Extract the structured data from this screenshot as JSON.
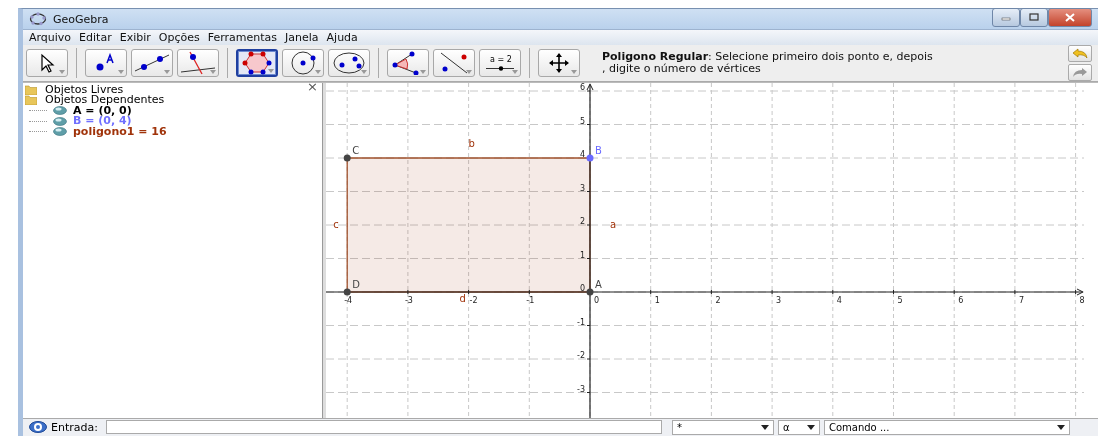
{
  "window": {
    "title": "GeoGebra"
  },
  "menu": [
    "Arquivo",
    "Editar",
    "Exibir",
    "Opções",
    "Ferramentas",
    "Janela",
    "Ajuda"
  ],
  "toolbar": {
    "tools": [
      {
        "kind": "pointer",
        "selected": false
      },
      {
        "kind": "point",
        "selected": false
      },
      {
        "kind": "line",
        "selected": false
      },
      {
        "kind": "perpendicular",
        "selected": false
      },
      {
        "kind": "polygon",
        "selected": true
      },
      {
        "kind": "circle",
        "selected": false
      },
      {
        "kind": "conic",
        "selected": false
      },
      {
        "kind": "angle",
        "selected": false
      },
      {
        "kind": "reflect",
        "selected": false
      },
      {
        "kind": "slider",
        "selected": false,
        "label": "a = 2"
      },
      {
        "kind": "move-view",
        "selected": false
      }
    ],
    "help": [
      "**Poligono Regular**: Selecione primeiro dois ponto e, depois",
      ", digite o número de vértices"
    ]
  },
  "algebra": {
    "close": "×",
    "folders": [
      {
        "label": "Objetos Livres"
      },
      {
        "label": "Objetos Dependentes",
        "children": [
          {
            "label": "A = (0, 0)",
            "color": "#000000"
          },
          {
            "label": "B = (0, 4)",
            "color": "#7070ff"
          },
          {
            "label": "poligono1 = 16",
            "color": "#a0330a"
          }
        ]
      }
    ]
  },
  "graphics": {
    "xticks": [
      "-4",
      "-3",
      "-2",
      "-1",
      "0",
      "1",
      "2",
      "3",
      "4",
      "5",
      "6",
      "7",
      "8"
    ],
    "yticks": [
      "6",
      "5",
      "4",
      "3",
      "2",
      "1",
      "0",
      "-1",
      "-2",
      "-3"
    ],
    "points": [
      {
        "label": "C",
        "color": "#444444"
      },
      {
        "label": "B",
        "color": "#6a6aff"
      },
      {
        "label": "D",
        "color": "#444444"
      },
      {
        "label": "A",
        "color": "#444444"
      }
    ],
    "segments": [
      {
        "label": "b"
      },
      {
        "label": "c"
      },
      {
        "label": "a"
      },
      {
        "label": "d"
      }
    ]
  },
  "input": {
    "label": "Entrada:",
    "symbols": "*",
    "greek": "α",
    "command": "Comando ..."
  }
}
